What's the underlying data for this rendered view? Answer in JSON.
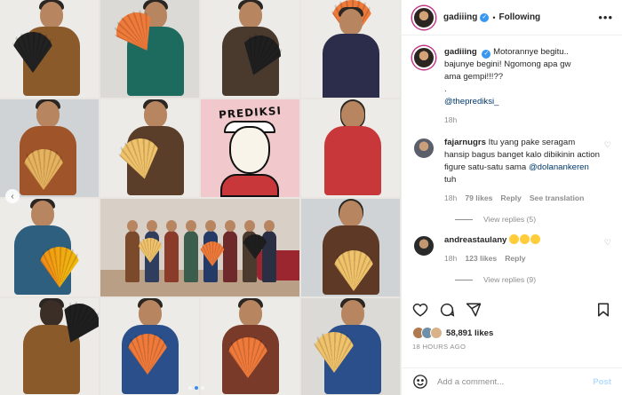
{
  "post": {
    "username": "gadiiing",
    "follow_status": "Following",
    "caption_lines": [
      "Motorannye begitu..",
      "bajunye begini! Ngomong apa gw",
      "ama gempi!!!??",
      "."
    ],
    "caption_mention": "@theprediksi_",
    "caption_time": "18h",
    "likes": "58,891 likes",
    "time_ago": "18 HOURS AGO"
  },
  "media": {
    "card_title": "PREDIKSI",
    "active_slide": 2,
    "slide_count": 3
  },
  "comments": [
    {
      "username": "fajarnugrs",
      "text": "Itu yang pake seragam hansip bagus banget kalo dibikinin action figure satu-satu sama",
      "mention": "@dolanankeren",
      "text_after": " tuh",
      "time": "18h",
      "likes": "79 likes",
      "reply": "Reply",
      "translation": "See translation",
      "view_replies": "View replies (5)"
    },
    {
      "username": "andreastaulany",
      "emoji": [
        "grinning-sweat",
        "grinning-sweat",
        "grinning-sweat"
      ],
      "time": "18h",
      "likes": "123 likes",
      "reply": "Reply",
      "view_replies": "View replies (9)"
    }
  ],
  "add_comment": {
    "placeholder": "Add a comment...",
    "post_label": "Post"
  },
  "colors": {
    "verified": "#3897f0",
    "link": "#00376b",
    "muted": "#8e8e8e",
    "post_disabled": "#b3dbff"
  },
  "icons": [
    "chevron-left-icon",
    "more-icon",
    "verified-icon",
    "heart-icon",
    "comment-icon",
    "share-icon",
    "bookmark-icon",
    "emoji-icon"
  ]
}
